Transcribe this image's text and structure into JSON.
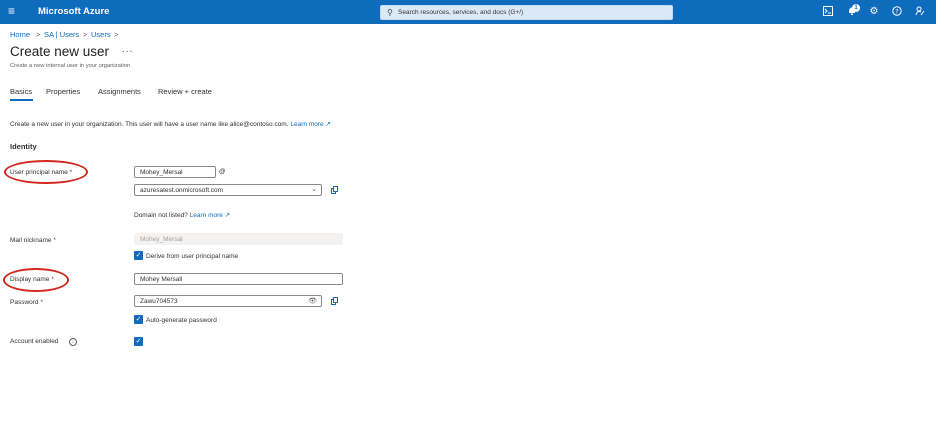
{
  "topbar": {
    "brand": "Microsoft Azure",
    "search_placeholder": "Search resources, services, and docs (G+/)",
    "notification_count": "1",
    "color": "#0f6cbd"
  },
  "breadcrumb": [
    "Home",
    "SA | Users",
    "Users"
  ],
  "page": {
    "title": "Create new user",
    "more": "...",
    "subtitle": "Create a new internal user in your organization"
  },
  "tabs": [
    "Basics",
    "Properties",
    "Assignments",
    "Review + create"
  ],
  "intro": {
    "text": "Create a new user in your organization. This user will have a user name like alice@contoso.com.",
    "link": "Learn more"
  },
  "identity": {
    "section_title": "Identity",
    "upn_label": "User principal name",
    "upn_value": "Mohey_Mersal",
    "at_symbol": "@",
    "domain_value": "azuresatest.onmicrosoft.com",
    "domain_not_listed": "Domain not listed?",
    "domain_link": "Learn more",
    "mail_label": "Mail nickname",
    "mail_value": "Mohey_Mersal",
    "derive_label": "Derive from user principal name",
    "display_label": "Display name",
    "display_value": "Mohey Mersall",
    "password_label": "Password",
    "password_value": "Zawu704573",
    "autogen_label": "Auto-generate password",
    "account_label": "Account enabled",
    "required_marker": "*"
  }
}
